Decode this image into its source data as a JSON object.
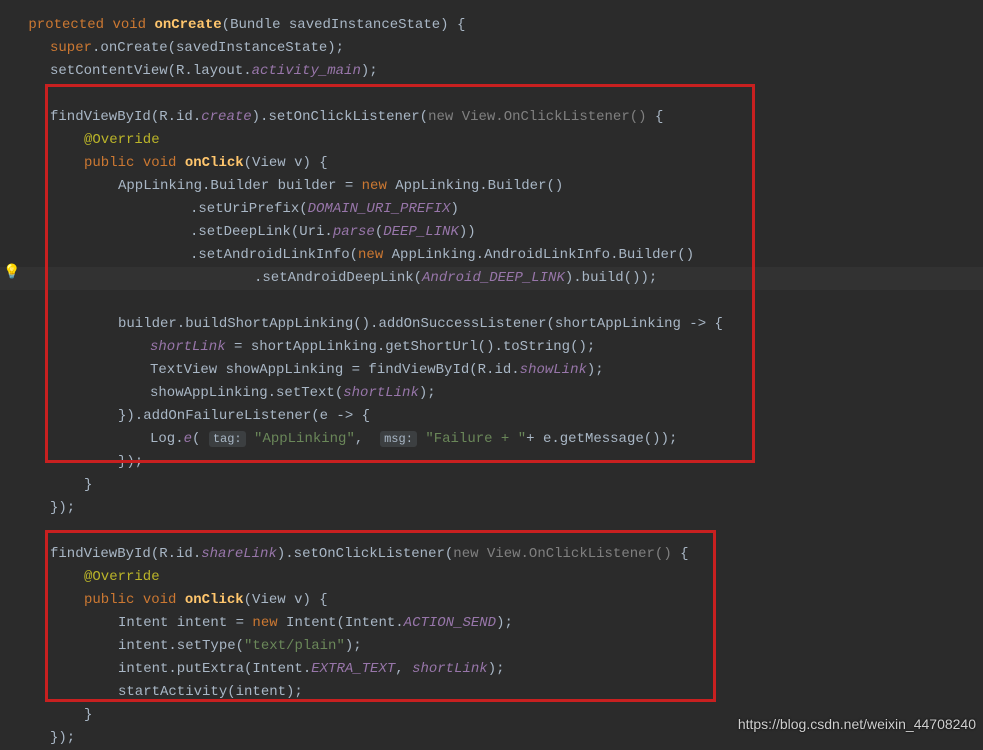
{
  "sig": {
    "protected": "protected",
    "void": "void",
    "onCreate": "onCreate",
    "bundle": "Bundle",
    "param": "savedInstanceState",
    "brace": " {"
  },
  "l2": {
    "super": "super",
    "dot": ".onCreate(savedInstanceState);"
  },
  "l3": {
    "setcv": "setContentView(R.layout.",
    "activity": "activity_main",
    "close": ");"
  },
  "l5": {
    "find": "findViewById(R.id.",
    "create": "create",
    "setoc": ").setOnClickListener(",
    "new": "new ",
    "viewoc": "View.OnClickListener()",
    "brace": " {"
  },
  "l6": {
    "anno": "@Override"
  },
  "l7": {
    "public": "public",
    "void": " void ",
    "onclick": "onClick",
    "params": "(View v) {"
  },
  "l8": {
    "text": "AppLinking.Builder builder = ",
    "new": "new",
    "text2": " AppLinking.Builder()"
  },
  "l9": {
    "dot": ".setUriPrefix(",
    "const": "DOMAIN_URI_PREFIX",
    "close": ")"
  },
  "l10": {
    "dot": ".setDeepLink(Uri.",
    "parse": "parse",
    "open": "(",
    "const": "DEEP_LINK",
    "close": "))"
  },
  "l11": {
    "dot": ".setAndroidLinkInfo(",
    "new": "new",
    "text": " AppLinking.AndroidLinkInfo.Builder()"
  },
  "l12": {
    "dot": ".setAndroidDeepLink(",
    "const": "Android_DEEP_LINK",
    "close": ").build());"
  },
  "l14": {
    "text": "builder.buildShortAppLinking().addOnSuccessListener(shortAppLinking -> {"
  },
  "l15": {
    "var": "shortLink",
    "text": " = shortAppLinking.getShortUrl().toString();"
  },
  "l16": {
    "text": "TextView showAppLinking = findViewById(R.id.",
    "showlink": "showLink",
    "close": ");"
  },
  "l17": {
    "text": "showAppLinking.setText(",
    "var": "shortLink",
    "close": ");"
  },
  "l18": {
    "text": "}).addOnFailureListener(e -> {"
  },
  "l19": {
    "log": "Log.",
    "e": "e",
    "open": "( ",
    "tag": "tag:",
    "str1": "\"AppLinking\"",
    "comma": ",  ",
    "msg": "msg:",
    "str2": "\"Failure + \"",
    "rest": "+ e.getMessage());"
  },
  "l20": {
    "close": "});"
  },
  "l21": {
    "brace": "}"
  },
  "l22": {
    "close": "});"
  },
  "l24": {
    "find": "findViewById(R.id.",
    "share": "shareLink",
    "setoc": ").setOnClickListener(",
    "new": "new ",
    "viewoc": "View.OnClickListener()",
    "brace": " {"
  },
  "l25": {
    "anno": "@Override"
  },
  "l26": {
    "public": "public",
    "void": " void ",
    "onclick": "onClick",
    "params": "(View v) {"
  },
  "l27": {
    "text": "Intent intent = ",
    "new": "new",
    "text2": " Intent(Intent.",
    "const": "ACTION_SEND",
    "close": ");"
  },
  "l28": {
    "text": "intent.setType(",
    "str": "\"text/plain\"",
    "close": ");"
  },
  "l29": {
    "text": "intent.putExtra(Intent.",
    "const": "EXTRA_TEXT",
    "comma": ", ",
    "var": "shortLink",
    "close": ");"
  },
  "l30": {
    "text": "startActivity(intent);"
  },
  "l31": {
    "brace": "}"
  },
  "l32": {
    "close": "});"
  },
  "watermark": "https://blog.csdn.net/weixin_44708240",
  "bulb": "💡"
}
